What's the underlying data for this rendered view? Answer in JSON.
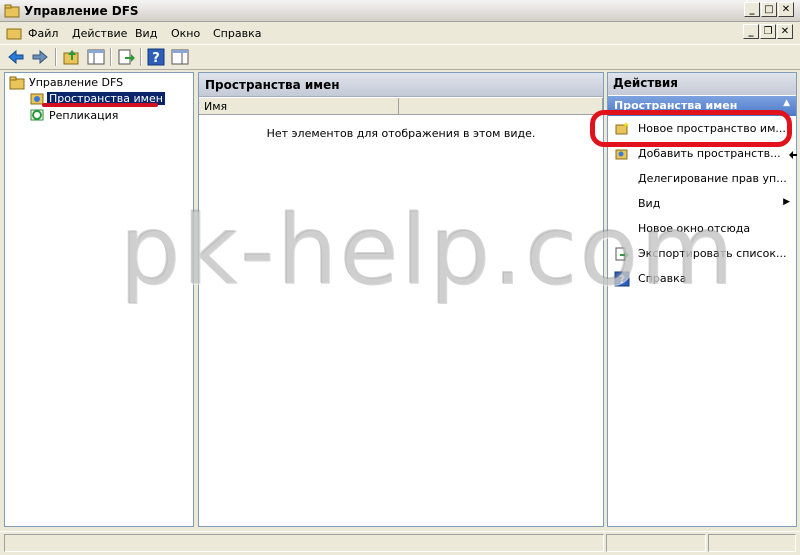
{
  "window": {
    "title": "Управление DFS"
  },
  "menu": [
    "Файл",
    "Действие",
    "Вид",
    "Окно",
    "Справка"
  ],
  "tree": {
    "root": "Управление DFS",
    "items": [
      "Пространства имен",
      "Репликация"
    ]
  },
  "center": {
    "header": "Пространства имен",
    "column": "Имя",
    "empty_message": "Нет элементов для отображения в этом виде."
  },
  "actions": {
    "header": "Действия",
    "section": "Пространства имен",
    "items": [
      "Новое пространство им...",
      "Добавить пространств...",
      "Делегирование прав уп...",
      "Вид",
      "Новое окно отсюда",
      "Экспортировать список...",
      "Справка"
    ]
  },
  "watermark": "pk-help.com",
  "colors": {
    "annotation": "#e2121c",
    "selection": "#0a246a"
  }
}
